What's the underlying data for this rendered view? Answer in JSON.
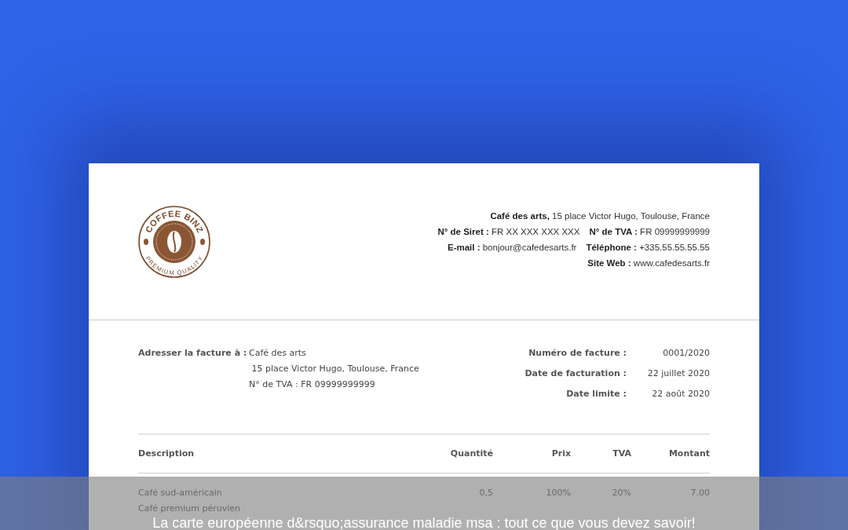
{
  "logo": {
    "top_text": "COFFEE BINZ",
    "bottom_text": "PREMIUM QUALITY"
  },
  "company": {
    "lines": [
      [
        "**Café des arts,** 15 place Victor Hugo, Toulouse, France"
      ],
      [
        "**N° de Siret :** FR XX XXX XXX XXX",
        "**N° de TVA :** FR 09999999999"
      ],
      [
        "**E-mail :** bonjour@cafedesarts.fr",
        "**Téléphone :** +335.55.55.55.55"
      ],
      [
        "**Site Web :** www.cafedesarts.fr"
      ]
    ]
  },
  "bill_to": {
    "label": "Adresser la facture à :",
    "lines": [
      "Café des arts",
      " 15 place Victor Hugo, Toulouse, France",
      "N° de TVA : FR 09999999999"
    ]
  },
  "meta": [
    {
      "label": "Numéro de facture :",
      "value": "0001/2020"
    },
    {
      "label": "Date de facturation :",
      "value": "22 juillet 2020"
    },
    {
      "label": "Date limite :",
      "value": "22 août 2020"
    }
  ],
  "table": {
    "columns": [
      "Description",
      "Quantité",
      "Prix",
      "TVA",
      "Montant"
    ],
    "rows": [
      {
        "cells": [
          "Café sud-américain",
          "0,5",
          "100%",
          "20%",
          "7.00"
        ]
      },
      {
        "cells": [
          "Café premium péruvien"
        ]
      }
    ]
  },
  "caption": "La carte européenne d&rsquo;assurance maladie msa : tout ce que vous devez savoir!"
}
